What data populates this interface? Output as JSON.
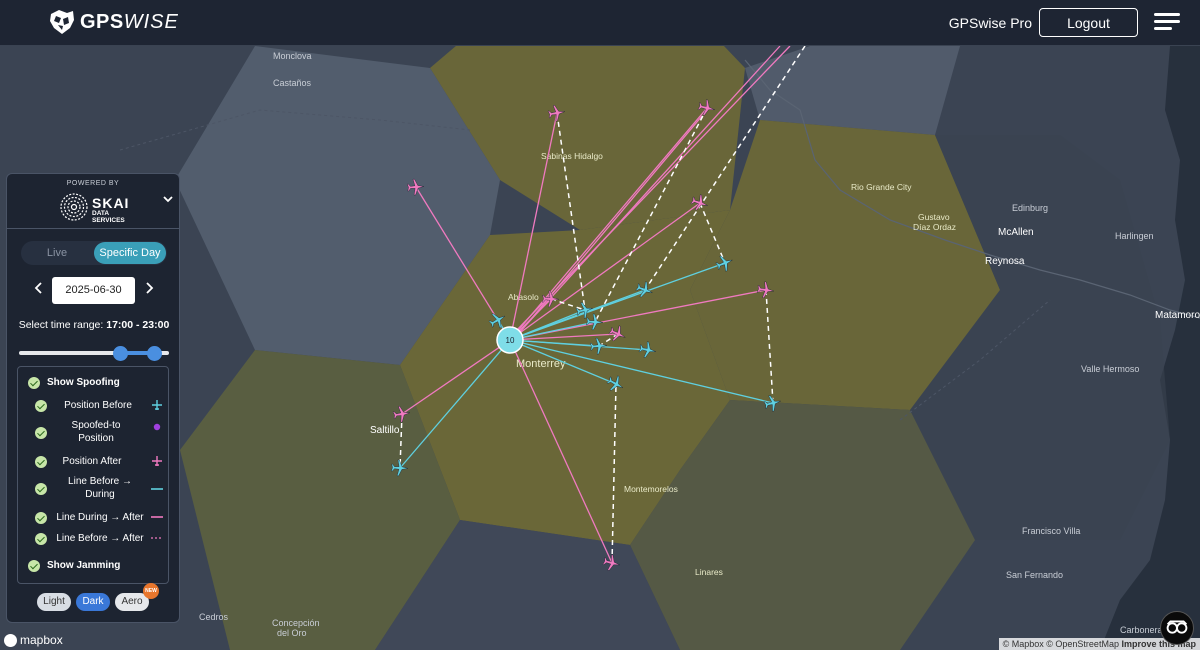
{
  "header": {
    "brand_bold": "GPS",
    "brand_light": "WISE",
    "pro_label": "GPSwise Pro",
    "logout_label": "Logout"
  },
  "panel": {
    "powered_by": "POWERED BY",
    "skai_name": "SKAI",
    "skai_sub": "DATA SERVICES",
    "mode_live": "Live",
    "mode_specific": "Specific Day",
    "mode_selected": "Specific Day",
    "date": "2025-06-30",
    "time_label": "Select time range:",
    "time_range": "17:00 - 23:00",
    "legend": {
      "show_spoofing": "Show Spoofing",
      "position_before": "Position Before",
      "spoofed_to": "Spoofed-to Position",
      "position_after": "Position After",
      "line_before_during": "Line Before → During",
      "line_during_after": "Line During → After",
      "line_before_after": "Line Before → After",
      "show_jamming": "Show Jamming"
    },
    "themes": [
      "Light",
      "Dark",
      "Aero"
    ],
    "theme_selected": "Dark",
    "new_badge": "NEW"
  },
  "map": {
    "cluster_count": "10",
    "cities": {
      "monclova": "Monclova",
      "castanos": "Castaños",
      "sabinas": "Sabinas Hidalgo",
      "abasolo": "Abasolo",
      "monterrey": "Monterrey",
      "saltillo": "Saltillo",
      "montemorelos": "Montemorelos",
      "linares": "Linares",
      "rio_grande": "Rio Grande City",
      "gustavo": "Gustavo\nDíaz Ordaz",
      "edinburg": "Edinburg",
      "mcallen": "McAllen",
      "harlingen": "Harlingen",
      "reynosa": "Reynosa",
      "matamoros": "Matamoros",
      "valle_hermoso": "Valle Hermoso",
      "francisco_villa": "Francisco Villa",
      "san_fernando": "San Fernando",
      "carboneras": "Carboneras",
      "cedros": "Cedros",
      "concepcion": "Concepción\ndel Oro"
    },
    "colors": {
      "land": "#3d4656",
      "hex_gray": "#4a5566",
      "hex_yellow": "#6e6b3a",
      "hex_dark": "#3a4250",
      "before": "#5fd0e0",
      "after": "#f07ac0",
      "spoofed": "#a040e0",
      "line_before_after": "#ffffff",
      "accent": "#3a9fb8",
      "cluster": "#5fd0e0"
    }
  },
  "footer": {
    "mapbox": "mapbox",
    "attribution_mapbox": "© Mapbox",
    "attribution_osm": "© OpenStreetMap",
    "attribution_improve": "Improve this map"
  }
}
